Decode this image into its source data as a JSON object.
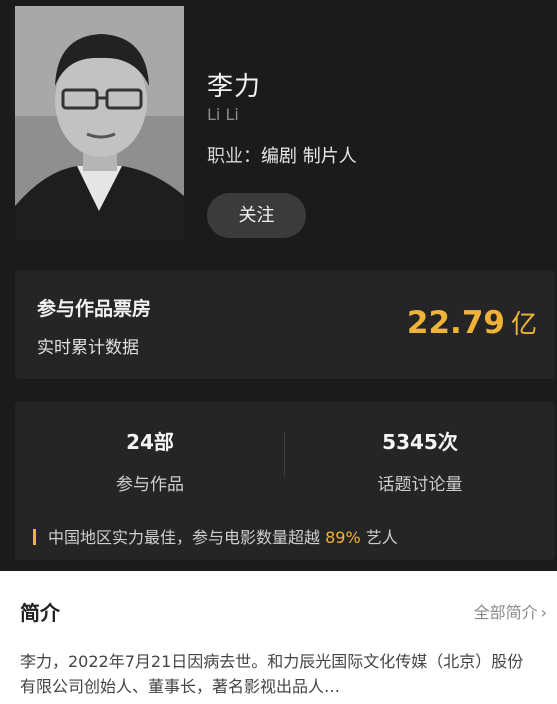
{
  "profile": {
    "name": "李力",
    "pinyin": "Li Li",
    "job_label": "职业：",
    "job_value": "编剧 制片人",
    "follow_label": "关注"
  },
  "box_office": {
    "title": "参与作品票房",
    "subtitle": "实时累计数据",
    "value": "22.79",
    "unit": "亿",
    "accent_color": "#f0b33a"
  },
  "stats": {
    "works_value": "24部",
    "works_label": "参与作品",
    "topics_value": "5345次",
    "topics_label": "话题讨论量",
    "tip_prefix": "中国地区实力最佳，参与电影数量超越",
    "tip_percent": "89%",
    "tip_suffix": "艺人"
  },
  "intro": {
    "title": "简介",
    "more_label": "全部简介",
    "more_icon": "chevron-right-icon",
    "text": "李力，2022年7月21日因病去世。和力辰光国际文化传媒（北京）股份有限公司创始人、董事长，著名影视出品人…"
  }
}
